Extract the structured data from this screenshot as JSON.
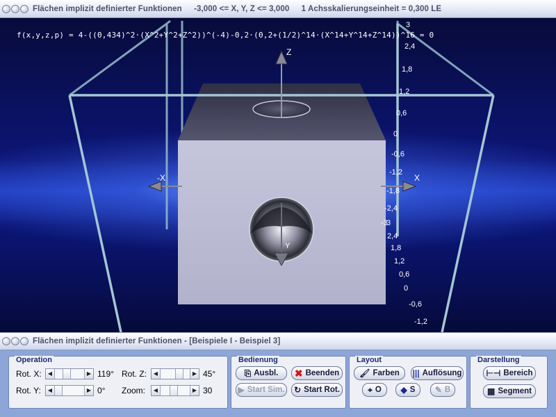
{
  "window": {
    "title_parts": [
      "Flächen implizit definierter Funktionen",
      "-3,000 <= X, Y, Z <= 3,000",
      "1 Achsskalierungseinheit = 0,300 LE"
    ]
  },
  "viewport": {
    "formula": "f(x,y,z,p) = 4-((0,434)^2·(X^2+Y^2+Z^2))^(-4)-0,2·(0,2+(1/2)^14·(X^14+Y^14+Z^14))^16 = 0",
    "axis_labels": {
      "z": "Z",
      "x_neg": "-X",
      "x_pos": "X",
      "y": "Y"
    },
    "scale_back": [
      "3",
      "2,4",
      "1,8",
      "1,2",
      "0,6",
      "0",
      "-0,6",
      "-1,2",
      "-1,8",
      "-2,4",
      "-3"
    ],
    "scale_front": [
      "3",
      "2,4",
      "1,8",
      "1,2",
      "0,6",
      "0",
      "-0,6",
      "-1,2"
    ]
  },
  "secondary_window": {
    "title": "Flächen implizit definierter Funktionen - [Beispiele I - Beispiel 3]"
  },
  "operation": {
    "title": "Operation",
    "rot_x_label": "Rot. X:",
    "rot_x_value": "119°",
    "rot_y_label": "Rot. Y:",
    "rot_y_value": "0°",
    "rot_z_label": "Rot. Z:",
    "rot_z_value": "45°",
    "zoom_label": "Zoom:",
    "zoom_value": "30"
  },
  "bedienung": {
    "title": "Bedienung",
    "ausbl": "Ausbl.",
    "beenden": "Beenden",
    "start_sim": "Start Sim.",
    "start_rot": "Start Rot."
  },
  "layout": {
    "title": "Layout",
    "farben": "Farben",
    "aufloesung": "Auflösung",
    "o_label": "O",
    "s_label": "S",
    "b_label": "B"
  },
  "darstellung": {
    "title": "Darstellung",
    "bereich": "Bereich",
    "segment": "Segment"
  },
  "colors": {
    "panel_bg": "#8ea5d8",
    "group_bg": "#eef0f6",
    "group_title": "#1b2a6e",
    "beenden_icon": "#d01818"
  }
}
